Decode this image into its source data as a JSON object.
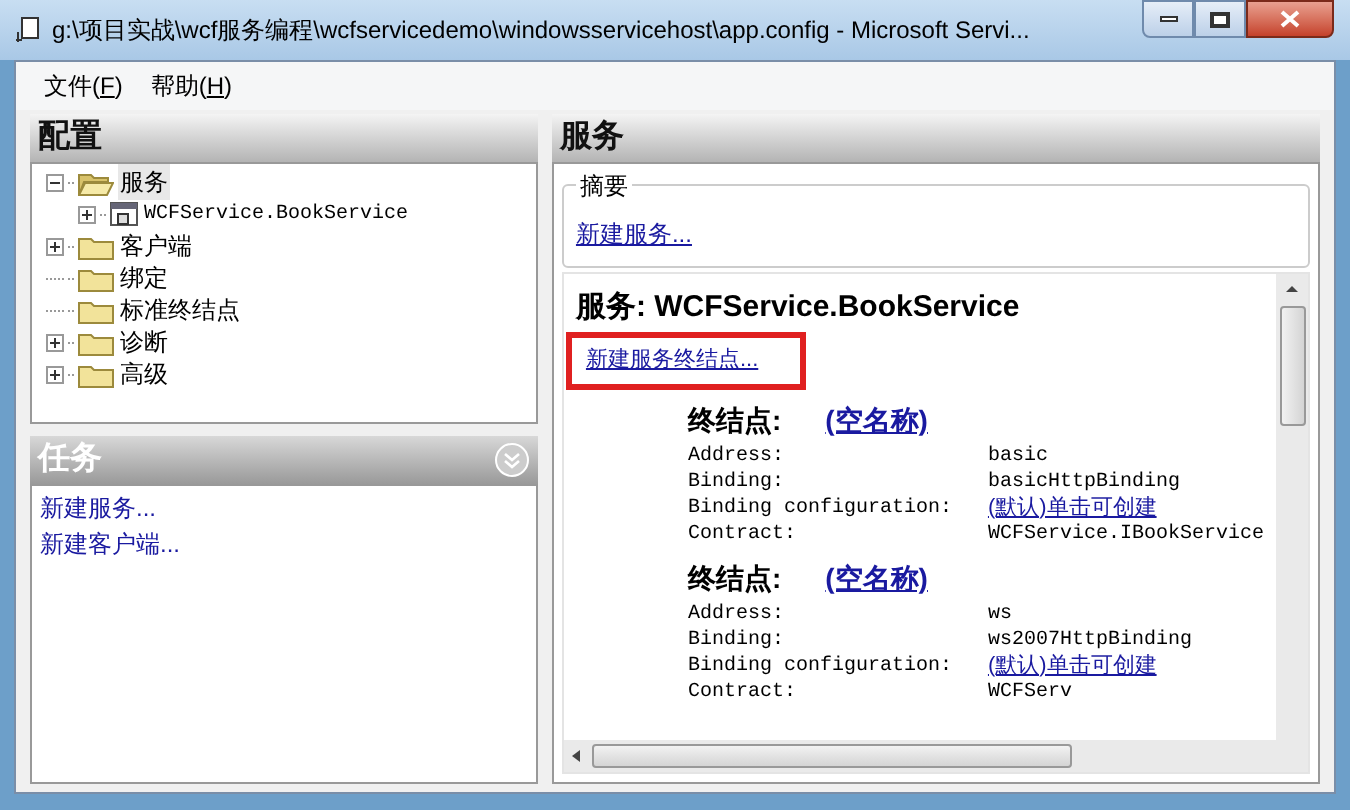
{
  "window": {
    "title": "g:\\项目实战\\wcf服务编程\\wcfservicedemo\\windowsservicehost\\app.config - Microsoft Servi..."
  },
  "menu": [
    {
      "label": "文件(",
      "key": "F",
      "end": ")"
    },
    {
      "label": "帮助(",
      "key": "H",
      "end": ")"
    }
  ],
  "config_panel": {
    "title": "配置",
    "tree": [
      {
        "label": "服务",
        "kind": "folder",
        "expandable": true,
        "expanded": true,
        "selected": true,
        "children": [
          {
            "label": "WCFService.BookService",
            "kind": "service",
            "expandable": true,
            "expanded": false,
            "selected": false
          }
        ]
      },
      {
        "label": "客户端",
        "kind": "folder",
        "expandable": true,
        "expanded": false,
        "selected": false
      },
      {
        "label": "绑定",
        "kind": "folder",
        "expandable": false,
        "selected": false
      },
      {
        "label": "标准终结点",
        "kind": "folder",
        "expandable": false,
        "selected": false
      },
      {
        "label": "诊断",
        "kind": "folder",
        "expandable": true,
        "expanded": false,
        "selected": false
      },
      {
        "label": "高级",
        "kind": "folder",
        "expandable": true,
        "expanded": false,
        "selected": false
      }
    ]
  },
  "tasks_panel": {
    "title": "任务",
    "links": [
      "新建服务...",
      "新建客户端..."
    ]
  },
  "service_panel": {
    "title": "服务",
    "summary": {
      "legend": "摘要",
      "link": "新建服务..."
    },
    "heading": "服务: WCFService.BookService",
    "new_endpoint_link": "新建服务终结点...",
    "endpoints": [
      {
        "label": "终结点:",
        "name": "(空名称)",
        "rows": [
          {
            "label": "Address:",
            "value": "basic",
            "kind": "text"
          },
          {
            "label": "Binding:",
            "value": "basicHttpBinding",
            "kind": "text"
          },
          {
            "label": "Binding configuration:",
            "value": "(默认)单击可创建",
            "kind": "link"
          },
          {
            "label": "Contract:",
            "value": "WCFService.IBookService",
            "kind": "text"
          }
        ]
      },
      {
        "label": "终结点:",
        "name": "(空名称)",
        "rows": [
          {
            "label": "Address:",
            "value": "ws",
            "kind": "text"
          },
          {
            "label": "Binding:",
            "value": "ws2007HttpBinding",
            "kind": "text"
          },
          {
            "label": "Binding configuration:",
            "value": "(默认)单击可创建",
            "kind": "link"
          },
          {
            "label": "Contract:",
            "value": "WCFServ",
            "kind": "text"
          }
        ]
      }
    ]
  }
}
